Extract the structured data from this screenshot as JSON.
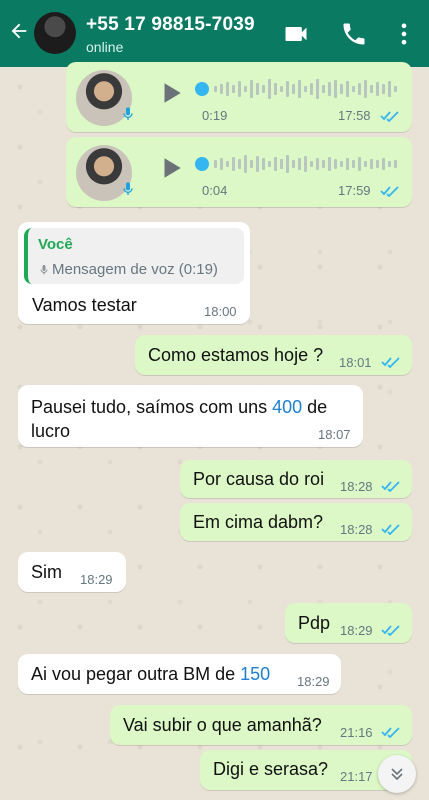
{
  "header": {
    "title": "+55 17 98815-7039",
    "status": "online"
  },
  "icons": {
    "back": "arrow-left-icon",
    "video": "video-icon",
    "call": "phone-icon",
    "menu": "more-vertical-icon"
  },
  "voice_messages": [
    {
      "duration": "0:19",
      "time": "17:58"
    },
    {
      "duration": "0:04",
      "time": "17:59"
    }
  ],
  "messages": [
    {
      "dir": "in",
      "quote_name": "Você",
      "quote_text": "Mensagem de voz (0:19)",
      "text": "Vamos testar",
      "time": "18:00"
    },
    {
      "dir": "out",
      "text": "Como estamos hoje ?",
      "time": "18:01"
    },
    {
      "dir": "in",
      "text_pre": "Pausei tudo, saímos com uns ",
      "text_hl": "400",
      "text_post": " de lucro",
      "time": "18:07"
    },
    {
      "dir": "out",
      "text": "Por causa do roi",
      "time": "18:28"
    },
    {
      "dir": "out",
      "text": "Em cima dabm?",
      "time": "18:28"
    },
    {
      "dir": "in",
      "text": "Sim",
      "time": "18:29"
    },
    {
      "dir": "out",
      "text": "Pdp",
      "time": "18:29"
    },
    {
      "dir": "in",
      "text_pre": "Ai vou pegar outra BM de ",
      "text_hl": "150",
      "time": "18:29"
    },
    {
      "dir": "out",
      "text": "Vai subir o que amanhã?",
      "time": "21:16"
    },
    {
      "dir": "out",
      "text": "Digi e serasa?",
      "time": "21:17"
    }
  ],
  "colors": {
    "header": "#0a7a63",
    "outgoing": "#dcf8c6",
    "incoming": "#ffffff",
    "read_ticks": "#34b7f1"
  }
}
